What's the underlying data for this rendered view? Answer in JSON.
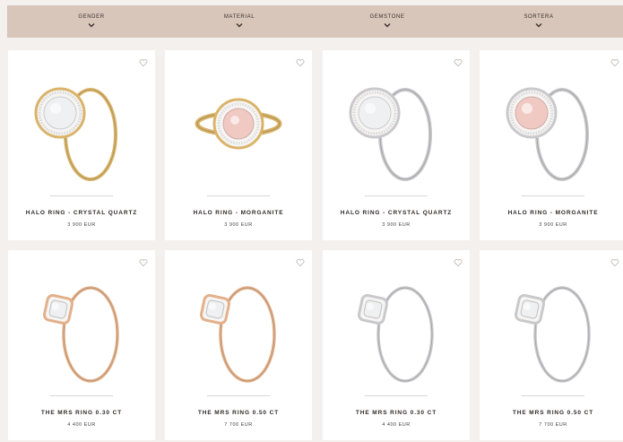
{
  "filters": [
    {
      "label": "GENDER"
    },
    {
      "label": "MATERIAL"
    },
    {
      "label": "GEMSTONE"
    },
    {
      "label": "SORTERA"
    }
  ],
  "products": [
    {
      "name": "HALO RING - CRYSTAL QUARTZ",
      "price": "3 900 EUR",
      "metal": "gold",
      "stone": "clear",
      "style": "halo-side"
    },
    {
      "name": "HALO RING - MORGANITE",
      "price": "3 900 EUR",
      "metal": "gold",
      "stone": "pink",
      "style": "halo-front"
    },
    {
      "name": "HALO RING - CRYSTAL QUARTZ",
      "price": "3 900 EUR",
      "metal": "silver",
      "stone": "clear",
      "style": "halo-side"
    },
    {
      "name": "HALO RING - MORGANITE",
      "price": "3 900 EUR",
      "metal": "silver",
      "stone": "pink",
      "style": "halo-side"
    },
    {
      "name": "THE MRS RING 0.30 CT",
      "price": "4 400 EUR",
      "metal": "rosegold",
      "stone": "clear",
      "style": "cushion"
    },
    {
      "name": "THE MRS RING 0.50 CT",
      "price": "7 700 EUR",
      "metal": "rosegold",
      "stone": "clear",
      "style": "cushion"
    },
    {
      "name": "THE MRS RING 0.30 CT",
      "price": "4 400 EUR",
      "metal": "silver",
      "stone": "clear",
      "style": "cushion"
    },
    {
      "name": "THE MRS RING 0.50 CT",
      "price": "7 700 EUR",
      "metal": "silver",
      "stone": "clear",
      "style": "cushion"
    }
  ],
  "colors": {
    "gold": "#d9b46a",
    "rosegold": "#e2b08a",
    "silver": "#c9c9cc",
    "clear": "#eef0f2",
    "pink": "#f1c9c3",
    "filter_bar": "#d8c6bb"
  },
  "icons": {
    "heart": "heart-outline-icon",
    "chevron": "chevron-down-icon"
  }
}
